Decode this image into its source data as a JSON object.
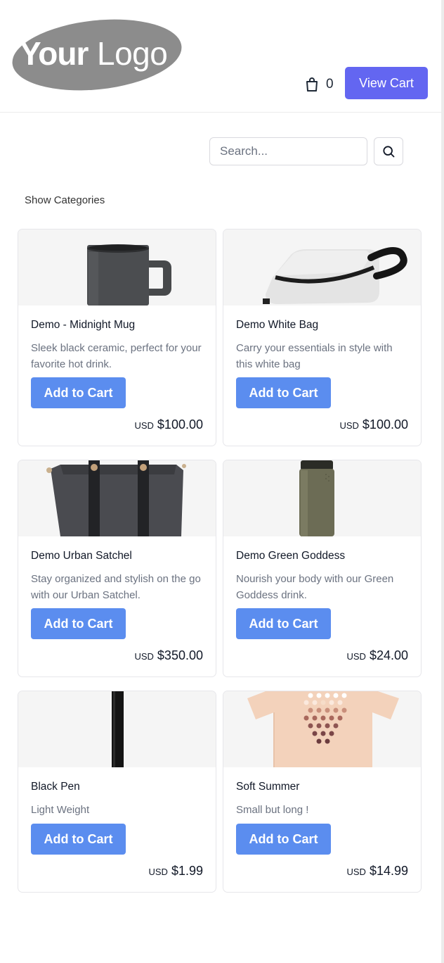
{
  "header": {
    "logo_text": "YourLogo",
    "cart_count": "0",
    "view_cart_label": "View Cart"
  },
  "search": {
    "placeholder": "Search..."
  },
  "categories_toggle": "Show Categories",
  "colors": {
    "primary": "#6366f1",
    "add_to_cart": "#5b8def"
  },
  "products": [
    {
      "title": "Demo - Midnight Mug",
      "description": "Sleek black ceramic, perfect for your favorite hot drink.",
      "button": "Add to Cart",
      "currency": "USD",
      "price": "$100.00",
      "image": "mug"
    },
    {
      "title": "Demo White Bag",
      "description": "Carry your essentials in style with this white bag",
      "button": "Add to Cart",
      "currency": "USD",
      "price": "$100.00",
      "image": "white-bag"
    },
    {
      "title": "Demo Urban Satchel",
      "description": "Stay organized and stylish on the go with our Urban Satchel.",
      "button": "Add to Cart",
      "currency": "USD",
      "price": "$350.00",
      "image": "satchel"
    },
    {
      "title": "Demo Green Goddess",
      "description": "Nourish your body with our Green Goddess drink.",
      "button": "Add to Cart",
      "currency": "USD",
      "price": "$24.00",
      "image": "bottle"
    },
    {
      "title": "Black Pen",
      "description": "Light Weight",
      "button": "Add to Cart",
      "currency": "USD",
      "price": "$1.99",
      "image": "pen"
    },
    {
      "title": "Soft Summer",
      "description": "Small but long !",
      "button": "Add to Cart",
      "currency": "USD",
      "price": "$14.99",
      "image": "tshirt"
    }
  ]
}
